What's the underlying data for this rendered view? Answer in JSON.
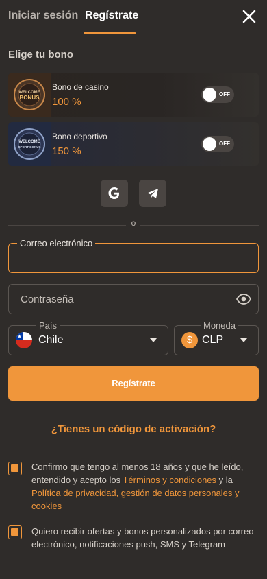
{
  "tabs": {
    "login": "Iniciar sesión",
    "register": "Regístrate"
  },
  "icons": {
    "close": "close-icon",
    "google": "google-icon",
    "telegram": "telegram-icon",
    "eye": "eye-icon",
    "caret": "chevron-down-icon"
  },
  "bonus": {
    "heading": "Elige tu bono",
    "cards": [
      {
        "art_text_1": "WELCOME",
        "art_text_2": "BONUS",
        "title": "Bono de casino",
        "value": "100 %",
        "toggle": "OFF"
      },
      {
        "art_text_1": "WELCOME",
        "art_text_2": "SPORT BONUS",
        "title": "Bono deportivo",
        "value": "150 %",
        "toggle": "OFF"
      }
    ]
  },
  "divider": {
    "text": "o"
  },
  "form": {
    "email_label": "Correo electrónico",
    "password_placeholder": "Contraseña",
    "country_label": "País",
    "country_value": "Chile",
    "currency_label": "Moneda",
    "currency_symbol": "$",
    "currency_value": "CLP",
    "submit": "Regístrate"
  },
  "activation": "¿Tienes un código de activación?",
  "consents": {
    "age": {
      "before": "Confirmo que tengo al menos 18 años y que he leído, entendido y acepto los ",
      "terms_link": "Términos y condiciones",
      "middle": " y la ",
      "privacy_link": "Política de privacidad, gestión de datos personales y cookies"
    },
    "offers": "Quiero recibir ofertas y bonos personalizados por correo electrónico, notificaciones push, SMS y Telegram"
  },
  "colors": {
    "accent": "#f0963b",
    "background": "#2f2c2a",
    "toggle_off": "#4a4542"
  }
}
